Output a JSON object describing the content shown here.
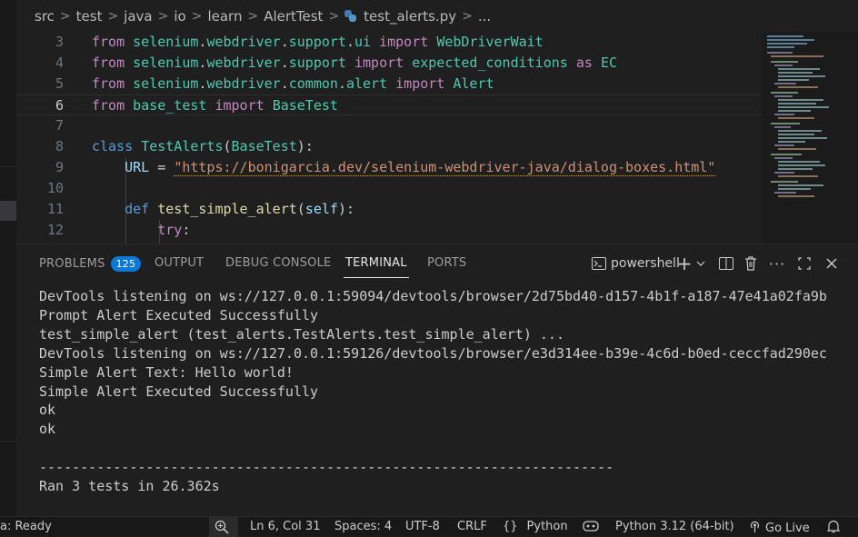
{
  "breadcrumb": [
    "src",
    "test",
    "java",
    "io",
    "learn",
    "AlertTest",
    "test_alerts.py",
    "..."
  ],
  "editor": {
    "lines": [
      {
        "n": "3",
        "code": "from selenium.webdriver.support.ui import WebDriverWait"
      },
      {
        "n": "4",
        "code": "from selenium.webdriver.support import expected_conditions as EC"
      },
      {
        "n": "5",
        "code": "from selenium.webdriver.common.alert import Alert"
      },
      {
        "n": "6",
        "code": "from base_test import BaseTest"
      },
      {
        "n": "7",
        "code": ""
      },
      {
        "n": "8",
        "code": "class TestAlerts(BaseTest):"
      },
      {
        "n": "9",
        "code": "    URL = \"https://bonigarcia.dev/selenium-webdriver-java/dialog-boxes.html\""
      },
      {
        "n": "10",
        "code": ""
      },
      {
        "n": "11",
        "code": "    def test_simple_alert(self):"
      },
      {
        "n": "12",
        "code": "        try:"
      }
    ],
    "active_line": "6"
  },
  "panel": {
    "tabs": [
      {
        "label": "PROBLEMS",
        "badge": "125"
      },
      {
        "label": "OUTPUT"
      },
      {
        "label": "DEBUG CONSOLE"
      },
      {
        "label": "TERMINAL"
      },
      {
        "label": "PORTS"
      }
    ],
    "active_tab": "TERMINAL",
    "shell": "powershell"
  },
  "terminal": {
    "lines": [
      "DevTools listening on ws://127.0.0.1:59094/devtools/browser/2d75bd40-d157-4b1f-a187-47e41a02fa9b",
      "Prompt Alert Executed Successfully",
      "test_simple_alert (test_alerts.TestAlerts.test_simple_alert) ...",
      "DevTools listening on ws://127.0.0.1:59126/devtools/browser/e3d314ee-b39e-4c6d-b0ed-ceccfad290ec",
      "Simple Alert Text: Hello world!",
      "Simple Alert Executed Successfully",
      "ok",
      "ok",
      "",
      "----------------------------------------------------------------------",
      "Ran 3 tests in 26.362s"
    ]
  },
  "status": {
    "left": "a: Ready",
    "position": "Ln 6, Col 31",
    "spaces": "Spaces: 4",
    "encoding": "UTF-8",
    "eol": "CRLF",
    "language": "Python",
    "interpreter": "Python 3.12 (64-bit)",
    "golive": "Go Live"
  },
  "colors": {
    "accent": "#0e78d5",
    "background": "#1f1f1f",
    "keyword": "#c586c0",
    "class": "#4ec9b0",
    "string": "#ce9178"
  }
}
